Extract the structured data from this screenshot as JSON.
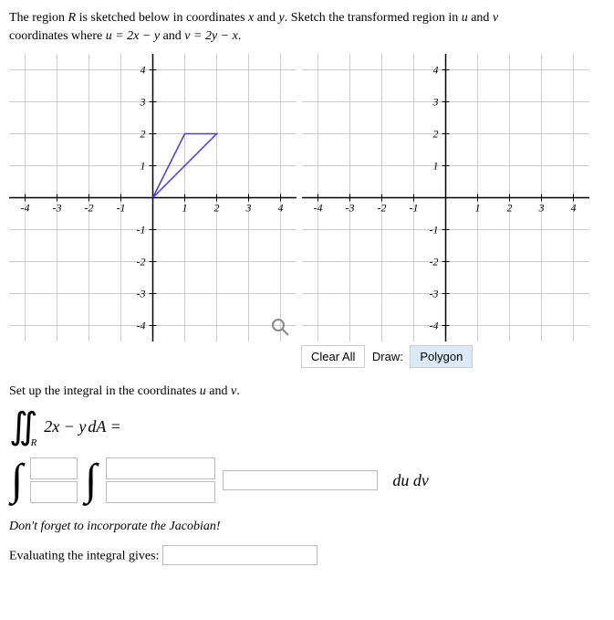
{
  "chart_data": [
    {
      "type": "line",
      "title": "",
      "xlabel": "",
      "ylabel": "",
      "xlim": [
        -4.5,
        4.5
      ],
      "ylim": [
        -4.5,
        4.5
      ],
      "xticks": [
        -4,
        -3,
        -2,
        -1,
        1,
        2,
        3,
        4
      ],
      "yticks": [
        -4,
        -3,
        -2,
        -1,
        1,
        2,
        3,
        4
      ],
      "shapes": [
        {
          "kind": "polygon",
          "stroke": "#4a3bd4",
          "fill": "none",
          "points": [
            [
              0,
              0
            ],
            [
              2,
              2
            ],
            [
              1,
              2
            ],
            [
              0,
              0
            ]
          ]
        }
      ]
    },
    {
      "type": "line",
      "title": "",
      "xlabel": "",
      "ylabel": "",
      "xlim": [
        -4.5,
        4.5
      ],
      "ylim": [
        -4.5,
        4.5
      ],
      "xticks": [
        -4,
        -3,
        -2,
        -1,
        1,
        2,
        3,
        4
      ],
      "yticks": [
        -4,
        -3,
        -2,
        -1,
        1,
        2,
        3,
        4
      ],
      "shapes": []
    }
  ],
  "problem": {
    "intro_prefix": "The region ",
    "R": "R",
    "intro_mid": " is sketched below in coordinates ",
    "x": "x",
    "y": "y",
    "u": "u",
    "v": "v",
    "and": " and ",
    "sentence_end": ". Sketch the transformed region in ",
    "coords_where": "coordinates where ",
    "eq1": "u = 2x − y",
    "eq_and": " and ",
    "eq2": "v = 2y − x",
    "period": "."
  },
  "toolbar": {
    "clear": "Clear All",
    "draw_label": "Draw:",
    "polygon": "Polygon"
  },
  "setup": {
    "line": "Set up the integral in the coordinates ",
    "line_end": ".",
    "integrand": "2x − y",
    "dA": " dA =",
    "dudv": "du dv"
  },
  "jacobian_note": "Don't forget to incorporate the Jacobian!",
  "eval_label": "Evaluating the integral gives: "
}
